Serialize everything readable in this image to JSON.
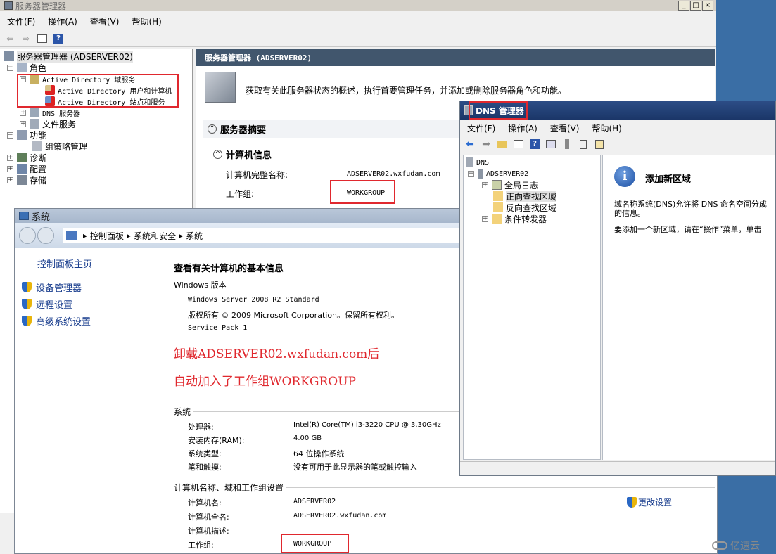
{
  "server_manager": {
    "title": "服务器管理器",
    "menu": [
      "文件(F)",
      "操作(A)",
      "查看(V)",
      "帮助(H)"
    ],
    "tree_root": "服务器管理器 (ADSERVER02)",
    "tree": {
      "roles": "角色",
      "ad_domain_services": "Active Directory 域服务",
      "ad_users": "Active Directory 用户和计算机",
      "ad_sites": "Active Directory 站点和服务",
      "dns_server": "DNS 服务器",
      "file_services": "文件服务",
      "features": "功能",
      "group_policy": "组策略管理",
      "diagnostics": "诊断",
      "configuration": "配置",
      "storage": "存储"
    },
    "header_title": "服务器管理器 (ADSERVER02)",
    "description": "获取有关此服务器状态的概述，执行首要管理任务，并添加或删除服务器角色和功能。",
    "summary_section": "服务器摘要",
    "computer_info_section": "计算机信息",
    "full_name_label": "计算机完整名称:",
    "full_name_value": "ADSERVER02.wxfudan.com",
    "workgroup_label": "工作组:",
    "workgroup_value": "WORKGROUP"
  },
  "system_window": {
    "title": "系统",
    "address": [
      "控制面板",
      "系统和安全",
      "系统"
    ],
    "sidebar": {
      "home": "控制面板主页",
      "links": [
        "设备管理器",
        "远程设置",
        "高级系统设置"
      ]
    },
    "heading": "查看有关计算机的基本信息",
    "windows_edition_label": "Windows 版本",
    "edition": "Windows Server 2008 R2 Standard",
    "copyright": "版权所有 © 2009 Microsoft Corporation。保留所有权利。",
    "service_pack": "Service Pack 1",
    "annotation_line1": "卸载ADSERVER02.wxfudan.com后",
    "annotation_line2": "自动加入了工作组WORKGROUP",
    "system_section": "系统",
    "system_rows": [
      {
        "label": "处理器:",
        "value": "Intel(R) Core(TM) i3-3220 CPU @ 3.30GHz"
      },
      {
        "label": "安装内存(RAM):",
        "value": "4.00 GB"
      },
      {
        "label": "系统类型:",
        "value": "64 位操作系统"
      },
      {
        "label": "笔和触摸:",
        "value": "没有可用于此显示器的笔或触控输入"
      }
    ],
    "name_section": "计算机名称、域和工作组设置",
    "name_rows": [
      {
        "label": "计算机名:",
        "value": "ADSERVER02"
      },
      {
        "label": "计算机全名:",
        "value": "ADSERVER02.wxfudan.com"
      },
      {
        "label": "计算机描述:",
        "value": ""
      },
      {
        "label": "工作组:",
        "value": "WORKGROUP"
      }
    ],
    "change_settings": "更改设置"
  },
  "dns_window": {
    "title": "DNS 管理器",
    "menu": [
      "文件(F)",
      "操作(A)",
      "查看(V)",
      "帮助(H)"
    ],
    "tree": {
      "root": "DNS",
      "server": "ADSERVER02",
      "global_logs": "全局日志",
      "forward_zones": "正向查找区域",
      "reverse_zones": "反向查找区域",
      "conditional_forwarders": "条件转发器"
    },
    "panel_title": "添加新区域",
    "panel_text1": "域名称系统(DNS)允许将 DNS 命名空间分成",
    "panel_text1b": "的信息。",
    "panel_text2": "要添加一个新区域，请在“操作”菜单，单击"
  },
  "watermark": "亿速云"
}
